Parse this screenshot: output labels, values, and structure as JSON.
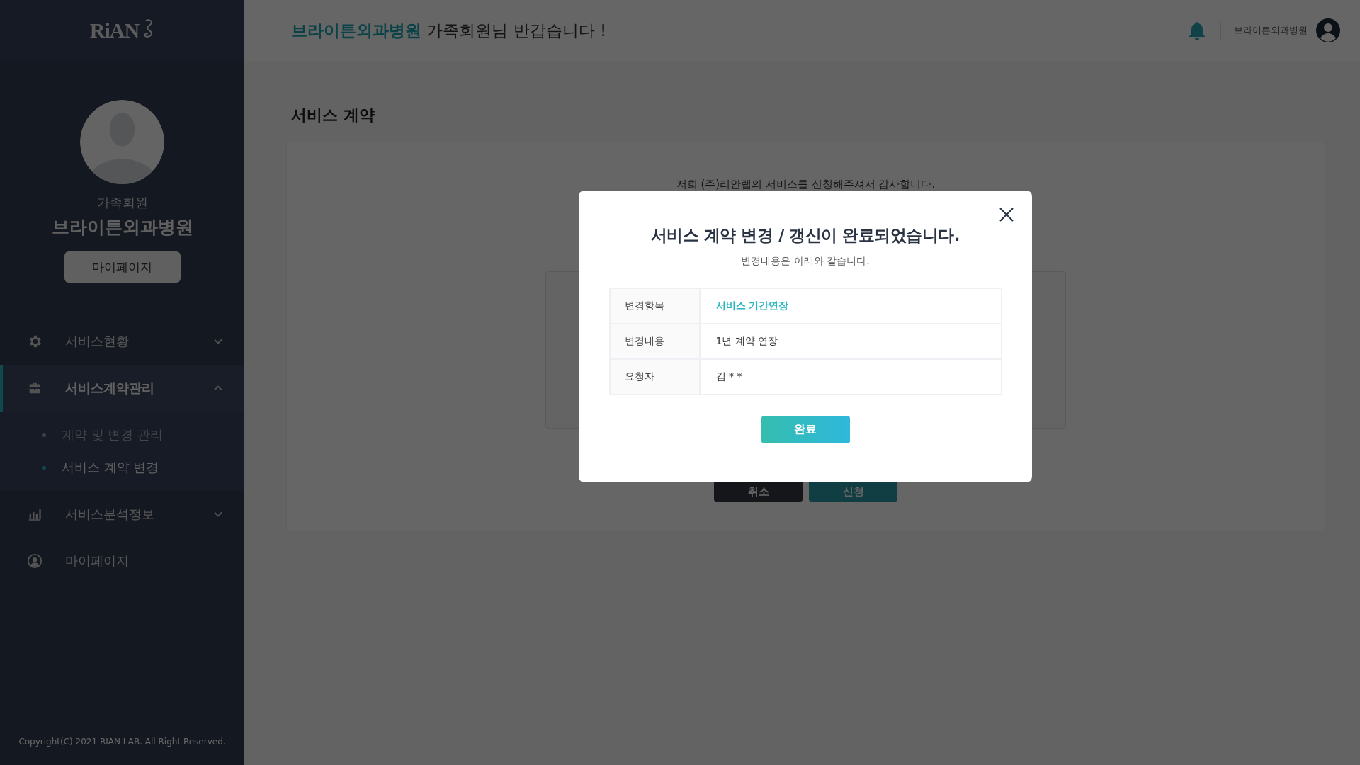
{
  "sidebar": {
    "logo": "RiAN",
    "profile": {
      "role": "가족회원",
      "name": "브라이튼외과병원",
      "button": "마이페이지"
    },
    "menu": [
      {
        "label": "서비스현황",
        "kind": "group",
        "expanded": false,
        "selected": false
      },
      {
        "label": "서비스계약관리",
        "kind": "group",
        "expanded": true,
        "selected": true,
        "children": [
          {
            "label": "계약 및 변경 관리",
            "selected": false
          },
          {
            "label": "서비스 계약 변경",
            "selected": true
          }
        ]
      },
      {
        "label": "서비스분석정보",
        "kind": "group",
        "expanded": false,
        "selected": false
      },
      {
        "label": "마이페이지",
        "kind": "link",
        "selected": false
      }
    ],
    "copyright": "Copyright(C) 2021 RIAN LAB. All Right Reserved."
  },
  "header": {
    "greeting_name": "브라이튼외과병원",
    "greeting_text": "가족회원님 반갑습니다 !",
    "user_name": "브라이튼외과병원"
  },
  "page": {
    "title": "서비스 계약",
    "intro": "저희 (주)리안랩의 서비스를 신청해주셔서 감사합니다.",
    "buttons": [
      {
        "label": "취소",
        "kind": "cancel"
      },
      {
        "label": "신청",
        "kind": "submit"
      }
    ]
  },
  "modal": {
    "title": "서비스 계약 변경 / 갱신이 완료되었습니다.",
    "subtitle": "변경내용은 아래와 같습니다.",
    "rows": [
      {
        "label": "변경항목",
        "value": "서비스 기간연장",
        "kind": "link"
      },
      {
        "label": "변경내용",
        "value": "1년 계약 연장",
        "kind": "text"
      },
      {
        "label": "요청자",
        "value": "김 * *",
        "kind": "text"
      }
    ],
    "button": "완료"
  }
}
